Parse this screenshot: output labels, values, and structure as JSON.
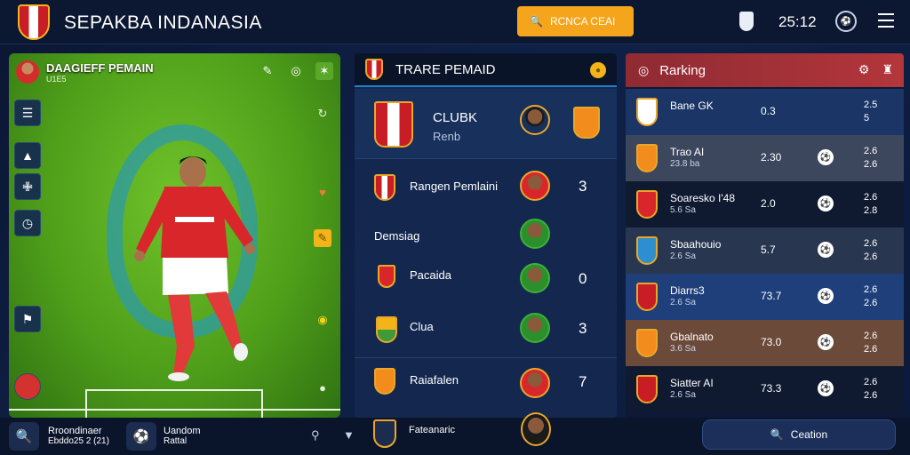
{
  "app": {
    "title": "SEPAKBA INDANASIA",
    "time": "25:12"
  },
  "top": {
    "search_label": "RCNCA CEAI",
    "menu_icon": "hamburger-menu-icon",
    "shield_icon": "shield-icon",
    "ball_icon": "ball-icon"
  },
  "left_panel": {
    "title": "DAAGIEFF PEMAIN",
    "subtitle": "U1E5"
  },
  "center_panel": {
    "title": "TRARE PEMAID",
    "club": {
      "name": "CLUBK",
      "sub": "Renb"
    },
    "rows": [
      {
        "label": "Rangen Pemlaini",
        "score": "3"
      },
      {
        "label": "Demsiag",
        "score": ""
      },
      {
        "label": "Pacaida",
        "score": "0"
      },
      {
        "label": "Clua",
        "score": "3"
      },
      {
        "label": "Raiafalen",
        "score": "7"
      }
    ],
    "footer_label": "Fateanaric"
  },
  "right_panel": {
    "title": "Rarking",
    "rows": [
      {
        "name": "Bane GK",
        "sub": "",
        "val": "0.3",
        "val2": "2.5",
        "sub2": "5",
        "has_ball": false,
        "bg": "#1a3566"
      },
      {
        "name": "Trao AI",
        "sub": "23.8 ba",
        "val": "2.30",
        "val2": "2.6",
        "sub2": "2.6",
        "has_ball": true,
        "bg": "#3c475e"
      },
      {
        "name": "Soaresko I'48",
        "sub": "5.6 Sa",
        "val": "2.0",
        "val2": "2.6",
        "sub2": "2.8",
        "has_ball": true,
        "bg": "#0f1a31"
      },
      {
        "name": "Sbaahouio",
        "sub": "2.6 Sa",
        "val": "5.7",
        "val2": "2.6",
        "sub2": "2.6",
        "has_ball": true,
        "bg": "#29364f"
      },
      {
        "name": "Diarrs3",
        "sub": "2.6 Sa",
        "val": "73.7",
        "val2": "2.6",
        "sub2": "2.6",
        "has_ball": true,
        "bg": "#1f3f7a"
      },
      {
        "name": "Gbalnato",
        "sub": "3.6 Sa",
        "val": "73.0",
        "val2": "2.6",
        "sub2": "2.6",
        "has_ball": true,
        "bg": "#6b4a3a"
      },
      {
        "name": "Siatter AI",
        "sub": "2.6 Sa",
        "val": "73.3",
        "val2": "2.6",
        "sub2": "2.6",
        "has_ball": true,
        "bg": "#0f1a31"
      }
    ]
  },
  "bottom": {
    "item1_title": "Rroondinaer",
    "item1_sub": "Ebddo25 2 (21)",
    "item2_title": "Uandom",
    "item2_sub": "Rattal",
    "search_label": "Ceation"
  }
}
